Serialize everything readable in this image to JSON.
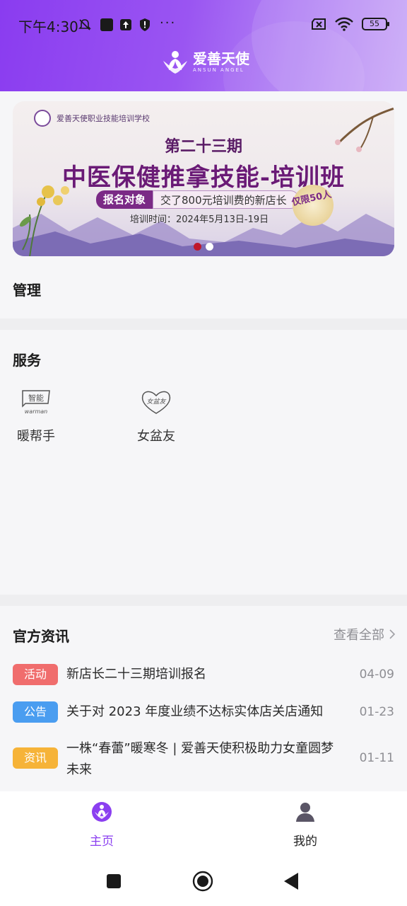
{
  "status_bar": {
    "time": "下午4:30",
    "dots": "···",
    "battery": "55"
  },
  "header": {
    "brand_name": "爱善天使",
    "brand_sub": "ANSUN ANGEL"
  },
  "banner": {
    "school": "爱善天使职业技能培训学校",
    "issue": "第二十三期",
    "course": "中医保健推拿技能-培训班",
    "target_label": "报名对象",
    "target_text": "交了800元培训费的新店长",
    "dates": "培训时间：2024年5月13日-19日",
    "seal": "仅限50人",
    "active_dot_color": "#c0182a"
  },
  "manage": {
    "title": "管理"
  },
  "services": {
    "title": "服务",
    "items": [
      {
        "label": "暖帮手",
        "icon": "zhineng-warman-icon",
        "icon_text": "智能",
        "icon_sub": "warman"
      },
      {
        "label": "女盆友",
        "icon": "heart-girlfriend-icon",
        "icon_text": "女盆友"
      }
    ]
  },
  "news": {
    "title": "官方资讯",
    "view_all": "查看全部",
    "items": [
      {
        "tag": "活动",
        "tag_color": "#f06d6d",
        "title": "新店长二十三期培训报名",
        "date": "04-09"
      },
      {
        "tag": "公告",
        "tag_color": "#4a9df0",
        "title": "关于对 2023 年度业绩不达标实体店关店通知",
        "date": "01-23"
      },
      {
        "tag": "资讯",
        "tag_color": "#f6b338",
        "title": "一株“春蕾”暖寒冬 | 爱善天使积极助力女童圆梦未来",
        "date": "01-11"
      }
    ]
  },
  "bottom_nav": {
    "home": "主页",
    "mine": "我的",
    "active_color": "#8b3ff0"
  }
}
